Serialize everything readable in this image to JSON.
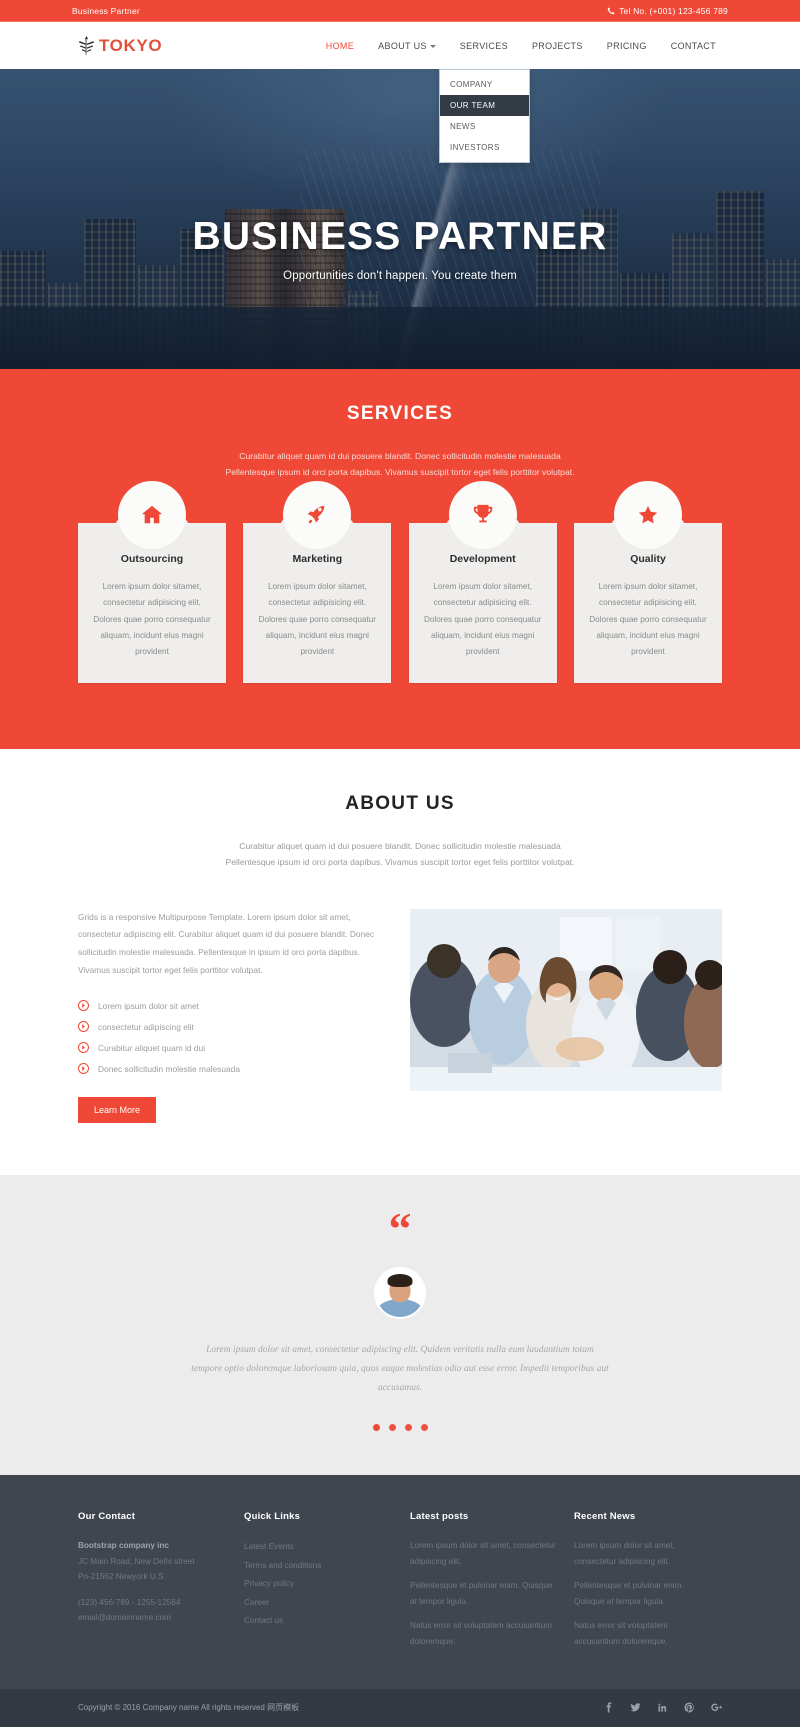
{
  "topbar": {
    "tagline": "Business Partner",
    "phone": "Tel No. (+001) 123-456 789",
    "phone_icon": "phone-icon"
  },
  "header": {
    "logo_text": "TOKYO",
    "logo_icon": "tree-logo-icon",
    "nav": [
      {
        "label": "HOME",
        "active": true
      },
      {
        "label": "ABOUT US",
        "active": false,
        "has_caret": true
      },
      {
        "label": "SERVICES",
        "active": false
      },
      {
        "label": "PROJECTS",
        "active": false
      },
      {
        "label": "PRICING",
        "active": false
      },
      {
        "label": "CONTACT",
        "active": false
      }
    ],
    "dropdown": [
      {
        "label": "COMPANY",
        "active": false
      },
      {
        "label": "OUR TEAM",
        "active": true
      },
      {
        "label": "NEWS",
        "active": false
      },
      {
        "label": "INVESTORS",
        "active": false
      }
    ]
  },
  "hero": {
    "title": "BUSINESS PARTNER",
    "subtitle": "Opportunities don't happen. You create them"
  },
  "services": {
    "title": "SERVICES",
    "description": "Curabitur aliquet quam id dui posuere blandit. Donec sollicitudin molestie malesuada Pellentesque ipsum id orci porta dapibus. Vivamus suscipit tortor eget felis porttitor volutpat.",
    "cards": [
      {
        "icon": "home-icon",
        "title": "Outsourcing",
        "text": "Lorem ipsum dolor sitamet, consectetur adipisicing elit. Dolores quae porro consequatur aliquam, incidunt eius magni provident"
      },
      {
        "icon": "rocket-icon",
        "title": "Marketing",
        "text": "Lorem ipsum dolor sitamet, consectetur adipisicing elit. Dolores quae porro consequatur aliquam, incidunt eius magni provident"
      },
      {
        "icon": "trophy-icon",
        "title": "Development",
        "text": "Lorem ipsum dolor sitamet, consectetur adipisicing elit. Dolores quae porro consequatur aliquam, incidunt eius magni provident"
      },
      {
        "icon": "star-icon",
        "title": "Quality",
        "text": "Lorem ipsum dolor sitamet, consectetur adipisicing elit. Dolores quae porro consequatur aliquam, incidunt eius magni provident"
      }
    ]
  },
  "about": {
    "title": "ABOUT US",
    "description": "Curabitur aliquet quam id dui posuere blandit. Donec sollicitudin molestie malesuada Pellentesque ipsum id orci porta dapibus. Vivamus suscipit tortor eget felis porttitor volutpat.",
    "paragraph": "Grids is a responsive Multipurpose Template. Lorem ipsum dolor sit amet, consectetur adipiscing elit. Curabitur aliquet quam id dui posuere blandit. Donec sollicitudin molestie malesuada. Pellentesque in ipsum id orci porta dapibus. Vivamus suscipit tortor eget felis porttitor volutpat.",
    "bullets": [
      "Lorem ipsum dolor sit amet",
      "consectetur adipiscing elit",
      "Curabitur aliquet quam id dui",
      "Donec sollicitudin molestie malesuada"
    ],
    "button_label": "Learn More",
    "image_alt": "business-team-meeting-photo"
  },
  "testimonial": {
    "quote_icon": "quote-mark-icon",
    "avatar": "person-avatar",
    "text": "Lorem ipsum dolor sit amet, consectetur adipiscing elit. Quidem veritatis nulla eum laudantium totam tempore optio doloremque laboriosam quia, quos eaque molestias odio aut esse error. Impedit temporibus aut accusamus.",
    "dots": 4,
    "active_dot": 0
  },
  "footer": {
    "contact": {
      "heading": "Our Contact",
      "company": "Bootstrap company inc",
      "address_line1": "JC Main Road, New Delhi street",
      "address_line2": "Po-21562 Newyork U.S",
      "phone": "(123) 456-789 - 1255-12564",
      "email": "email@domainname.com"
    },
    "quick_links": {
      "heading": "Quick Links",
      "items": [
        "Latest Events",
        "Terms and conditions",
        "Privacy policy",
        "Career",
        "Contact us"
      ]
    },
    "latest_posts": {
      "heading": "Latest posts",
      "items": [
        "Lorem ipsum dolor sit amet, consectetur adipiscing elit.",
        "Pellentesque et pulvinar enim. Quisque at tempor ligula.",
        "Natus error sit voluptatem accusantium doloremque."
      ]
    },
    "recent_news": {
      "heading": "Recent News",
      "items": [
        "Lorem ipsum dolor sit amet, consectetur adipiscing elit.",
        "Pellentesque et pulvinar enim. Quisque at tempor ligula.",
        "Natus error sit voluptatem accusantium doloremque."
      ]
    }
  },
  "copyright": {
    "text": "Copyright © 2016 Company name All rights reserved 网页模板",
    "socials": [
      "facebook-icon",
      "twitter-icon",
      "linkedin-icon",
      "pinterest-icon",
      "google-plus-icon"
    ]
  },
  "colors": {
    "accent": "#ef4836",
    "footer_bg": "#3f4650",
    "copybar_bg": "#343a44",
    "testimonial_bg": "#ececec",
    "card_bg": "#efeeec"
  }
}
